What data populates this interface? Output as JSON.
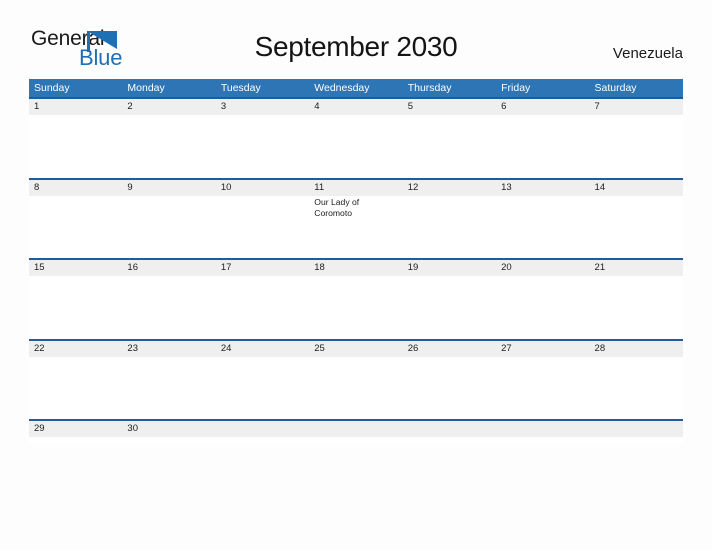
{
  "brand": {
    "name_part1": "General",
    "name_part2": "Blue",
    "flag_icon": "blue-triangle-flag-icon",
    "color_dark": "#1a1a1a",
    "color_blue": "#1f6fb5"
  },
  "header": {
    "title": "September 2030",
    "country": "Venezuela"
  },
  "colors": {
    "header_band": "#2e75b6",
    "row_divider": "#1f5c99",
    "number_band": "#efefef",
    "page_background": "#fdfdfd",
    "text": "#1d1d1d"
  },
  "calendar": {
    "weekdays": [
      "Sunday",
      "Monday",
      "Tuesday",
      "Wednesday",
      "Thursday",
      "Friday",
      "Saturday"
    ],
    "weeks": [
      {
        "days": [
          {
            "num": "1",
            "event": ""
          },
          {
            "num": "2",
            "event": ""
          },
          {
            "num": "3",
            "event": ""
          },
          {
            "num": "4",
            "event": ""
          },
          {
            "num": "5",
            "event": ""
          },
          {
            "num": "6",
            "event": ""
          },
          {
            "num": "7",
            "event": ""
          }
        ]
      },
      {
        "days": [
          {
            "num": "8",
            "event": ""
          },
          {
            "num": "9",
            "event": ""
          },
          {
            "num": "10",
            "event": ""
          },
          {
            "num": "11",
            "event": "Our Lady of Coromoto"
          },
          {
            "num": "12",
            "event": ""
          },
          {
            "num": "13",
            "event": ""
          },
          {
            "num": "14",
            "event": ""
          }
        ]
      },
      {
        "days": [
          {
            "num": "15",
            "event": ""
          },
          {
            "num": "16",
            "event": ""
          },
          {
            "num": "17",
            "event": ""
          },
          {
            "num": "18",
            "event": ""
          },
          {
            "num": "19",
            "event": ""
          },
          {
            "num": "20",
            "event": ""
          },
          {
            "num": "21",
            "event": ""
          }
        ]
      },
      {
        "days": [
          {
            "num": "22",
            "event": ""
          },
          {
            "num": "23",
            "event": ""
          },
          {
            "num": "24",
            "event": ""
          },
          {
            "num": "25",
            "event": ""
          },
          {
            "num": "26",
            "event": ""
          },
          {
            "num": "27",
            "event": ""
          },
          {
            "num": "28",
            "event": ""
          }
        ]
      },
      {
        "days": [
          {
            "num": "29",
            "event": ""
          },
          {
            "num": "30",
            "event": ""
          },
          {
            "num": "",
            "event": ""
          },
          {
            "num": "",
            "event": ""
          },
          {
            "num": "",
            "event": ""
          },
          {
            "num": "",
            "event": ""
          },
          {
            "num": "",
            "event": ""
          }
        ]
      }
    ]
  }
}
